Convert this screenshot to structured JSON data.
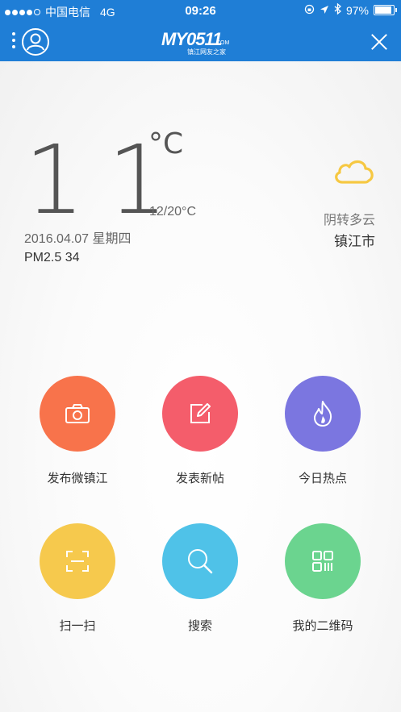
{
  "status_bar": {
    "carrier": "中国电信",
    "network": "4G",
    "time": "09:26",
    "battery": "97%"
  },
  "nav": {
    "logo_main": "MY0511",
    "logo_com": ".COM",
    "logo_sub": "镇江网友之家"
  },
  "weather": {
    "temperature": "11",
    "unit": "°C",
    "range": "12/20°C",
    "date": "2016.04.07 星期四",
    "pm25": "PM2.5 34",
    "condition": "阴转多云",
    "city": "镇江市",
    "icon": "cloud-icon"
  },
  "actions": [
    {
      "label": "发布微镇江",
      "icon": "camera-icon",
      "color": "#f8734b"
    },
    {
      "label": "发表新帖",
      "icon": "edit-icon",
      "color": "#f45d6b"
    },
    {
      "label": "今日热点",
      "icon": "flame-icon",
      "color": "#7b76e0"
    },
    {
      "label": "扫一扫",
      "icon": "scan-icon",
      "color": "#f6c94d"
    },
    {
      "label": "搜索",
      "icon": "search-icon",
      "color": "#4fc2e8"
    },
    {
      "label": "我的二维码",
      "icon": "qrcode-icon",
      "color": "#6bd48f"
    }
  ],
  "colors": {
    "brand": "#1f7ed6"
  }
}
